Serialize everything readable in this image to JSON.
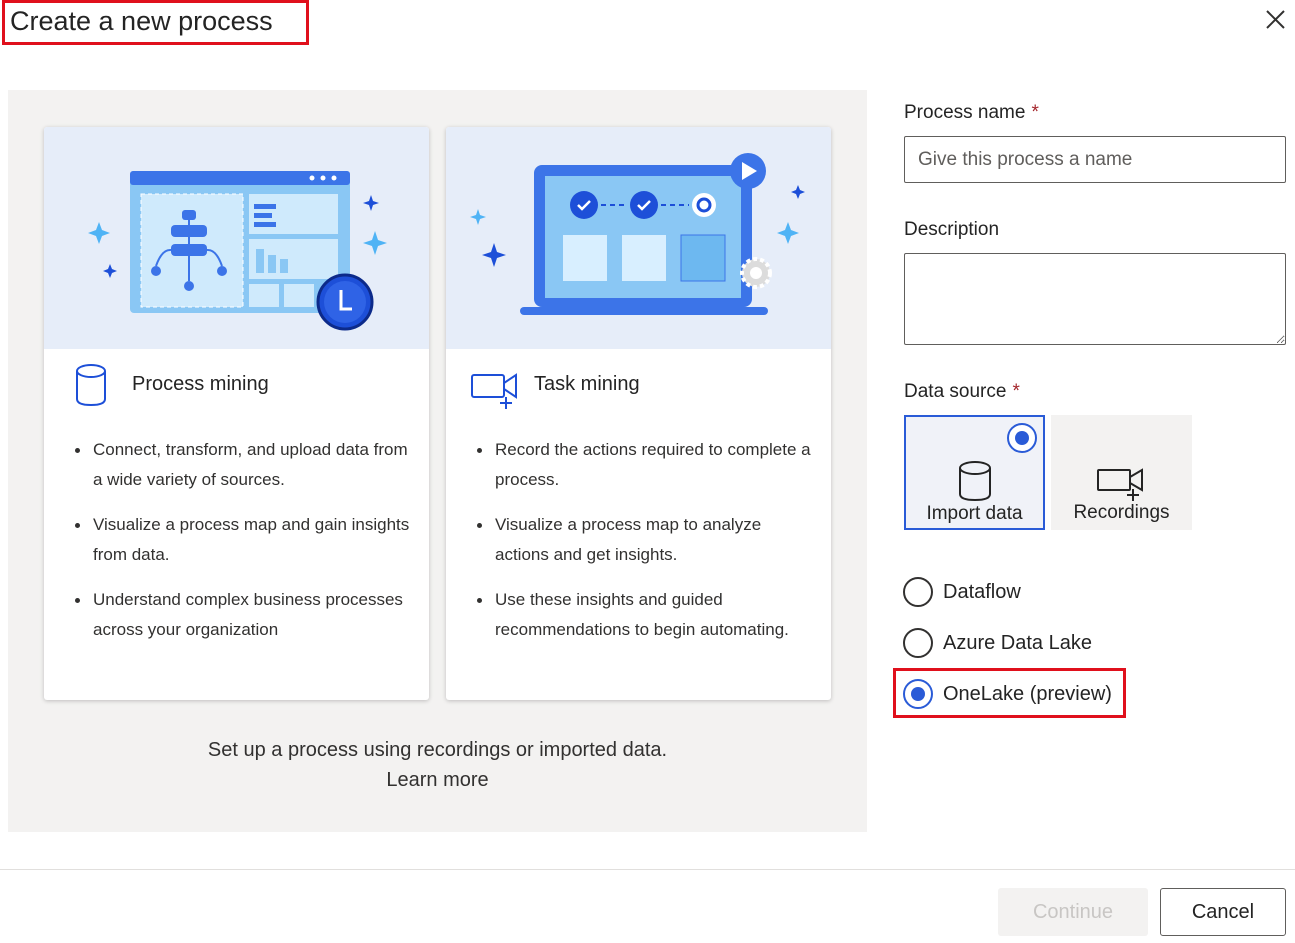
{
  "dialog": {
    "title": "Create a new process",
    "close_icon": "close-icon"
  },
  "cards": {
    "process_mining": {
      "title": "Process mining",
      "icon": "database-icon",
      "bullets": [
        "Connect, transform, and upload data from a wide variety of sources.",
        "Visualize a process map and gain insights from data.",
        "Understand complex business processes across your organization"
      ]
    },
    "task_mining": {
      "title": "Task mining",
      "icon": "video-add-icon",
      "bullets": [
        "Record the actions required to complete a process.",
        "Visualize a process map to analyze actions and get insights.",
        "Use these insights and guided recommendations to begin automating."
      ]
    }
  },
  "footer": {
    "text": "Set up a process using recordings or imported data.",
    "learn_more": "Learn more"
  },
  "form": {
    "process_name": {
      "label": "Process name",
      "required_mark": "*",
      "placeholder": "Give this process a name",
      "value": ""
    },
    "description": {
      "label": "Description",
      "value": ""
    },
    "data_source": {
      "label": "Data source",
      "required_mark": "*",
      "tiles": [
        {
          "label": "Import data",
          "icon": "database-icon",
          "selected": true
        },
        {
          "label": "Recordings",
          "icon": "video-add-icon",
          "selected": false
        }
      ],
      "options": [
        {
          "label": "Dataflow",
          "selected": false
        },
        {
          "label": "Azure Data Lake",
          "selected": false
        },
        {
          "label": "OneLake (preview)",
          "selected": true
        }
      ]
    }
  },
  "buttons": {
    "continue": "Continue",
    "cancel": "Cancel"
  },
  "colors": {
    "accent": "#2a5bd7",
    "highlight": "#e0101c",
    "panel_bg": "#f3f2f1",
    "hero_bg": "#e6edf9"
  }
}
